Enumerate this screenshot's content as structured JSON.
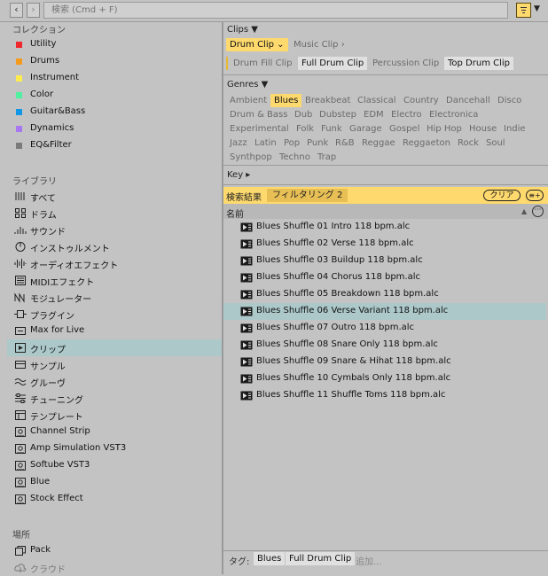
{
  "topbar": {
    "back_icon": "chevron-left-icon",
    "forward_icon": "chevron-right-icon",
    "search_placeholder": "検索 (Cmd + F)",
    "filter_icon": "filter-view-icon",
    "dropdown_glyph": "▼"
  },
  "sidebar": {
    "collections_title": "コレクション",
    "collections": [
      {
        "label": "Utility",
        "color": "#f0282d"
      },
      {
        "label": "Drums",
        "color": "#f49a1d"
      },
      {
        "label": "Instrument",
        "color": "#fcec4e"
      },
      {
        "label": "Color",
        "color": "#4ff0a0"
      },
      {
        "label": "Guitar&Bass",
        "color": "#1296e6"
      },
      {
        "label": "Dynamics",
        "color": "#a878f0"
      },
      {
        "label": "EQ&Filter",
        "color": "#7a7a7a"
      }
    ],
    "library_title": "ライブラリ",
    "library": [
      {
        "label": "すべて",
        "icon": "all-items-icon"
      },
      {
        "label": "ドラム",
        "icon": "drums-grid-icon"
      },
      {
        "label": "サウンド",
        "icon": "sounds-icon"
      },
      {
        "label": "インストゥルメント",
        "icon": "instrument-icon"
      },
      {
        "label": "オーディオエフェクト",
        "icon": "audio-effect-icon"
      },
      {
        "label": "MIDIエフェクト",
        "icon": "midi-effect-icon"
      },
      {
        "label": "モジュレーター",
        "icon": "modulator-icon"
      },
      {
        "label": "プラグイン",
        "icon": "plugin-icon"
      },
      {
        "label": "Max for Live",
        "icon": "max-for-live-icon"
      },
      {
        "label": "クリップ",
        "icon": "clip-icon",
        "selected": true
      },
      {
        "label": "サンプル",
        "icon": "sample-icon"
      },
      {
        "label": "グルーヴ",
        "icon": "groove-icon"
      },
      {
        "label": "チューニング",
        "icon": "tuning-icon"
      },
      {
        "label": "テンプレート",
        "icon": "template-icon"
      },
      {
        "label": "Channel Strip",
        "icon": "pack-folder-icon"
      },
      {
        "label": "Amp Simulation VST3",
        "icon": "pack-folder-icon"
      },
      {
        "label": "Softube VST3",
        "icon": "pack-folder-icon"
      },
      {
        "label": "Blue",
        "icon": "pack-folder-icon"
      },
      {
        "label": "Stock Effect",
        "icon": "pack-folder-icon"
      }
    ],
    "places_title": "場所",
    "places": [
      {
        "label": "Pack",
        "icon": "pack-icon"
      },
      {
        "label": "クラウド",
        "icon": "cloud-icon"
      }
    ]
  },
  "filters": {
    "clips_header": "Clips ▼",
    "clip_types": [
      {
        "label": "Drum Clip ⌄",
        "state": "selected"
      },
      {
        "label": "Music Clip ›",
        "state": "muted"
      }
    ],
    "clip_subtypes": [
      {
        "label": "Drum Fill Clip",
        "state": "muted"
      },
      {
        "label": "Full Drum Clip",
        "state": "boxed"
      },
      {
        "label": "Percussion Clip",
        "state": "muted"
      },
      {
        "label": "Top Drum Clip",
        "state": "boxed"
      }
    ],
    "genres_header": "Genres ▼",
    "genres": [
      {
        "label": "Ambient",
        "state": "muted"
      },
      {
        "label": "Blues",
        "state": "selected"
      },
      {
        "label": "Breakbeat",
        "state": "muted"
      },
      {
        "label": "Classical",
        "state": "muted"
      },
      {
        "label": "Country",
        "state": "muted"
      },
      {
        "label": "Dancehall",
        "state": "muted"
      },
      {
        "label": "Disco",
        "state": "muted"
      },
      {
        "label": "Drum & Bass",
        "state": "muted"
      },
      {
        "label": "Dub",
        "state": "muted"
      },
      {
        "label": "Dubstep",
        "state": "muted"
      },
      {
        "label": "EDM",
        "state": "muted"
      },
      {
        "label": "Electro",
        "state": "muted"
      },
      {
        "label": "Electronica",
        "state": "muted"
      },
      {
        "label": "Experimental",
        "state": "muted"
      },
      {
        "label": "Folk",
        "state": "muted"
      },
      {
        "label": "Funk",
        "state": "muted"
      },
      {
        "label": "Garage",
        "state": "muted"
      },
      {
        "label": "Gospel",
        "state": "muted"
      },
      {
        "label": "Hip Hop",
        "state": "muted"
      },
      {
        "label": "House",
        "state": "muted"
      },
      {
        "label": "Indie",
        "state": "muted"
      },
      {
        "label": "Jazz",
        "state": "muted"
      },
      {
        "label": "Latin",
        "state": "muted"
      },
      {
        "label": "Pop",
        "state": "muted"
      },
      {
        "label": "Punk",
        "state": "muted"
      },
      {
        "label": "R&B",
        "state": "muted"
      },
      {
        "label": "Reggae",
        "state": "muted"
      },
      {
        "label": "Reggaeton",
        "state": "muted"
      },
      {
        "label": "Rock",
        "state": "muted"
      },
      {
        "label": "Soul",
        "state": "muted"
      },
      {
        "label": "Synthpop",
        "state": "muted"
      },
      {
        "label": "Techno",
        "state": "muted"
      },
      {
        "label": "Trap",
        "state": "muted"
      }
    ],
    "key_header": "Key ▸"
  },
  "results": {
    "label": "検索結果",
    "filter_badge": "フィルタリング 2",
    "clear_label": "クリア",
    "add_glyph": "≡+",
    "column_name": "名前",
    "sort_glyph": "▲",
    "options_glyph": "···",
    "items": [
      {
        "name": "Blues Shuffle 01 Intro 118 bpm.alc"
      },
      {
        "name": "Blues Shuffle 02 Verse 118 bpm.alc"
      },
      {
        "name": "Blues Shuffle 03 Buildup 118 bpm.alc"
      },
      {
        "name": "Blues Shuffle 04 Chorus 118 bpm.alc"
      },
      {
        "name": "Blues Shuffle 05 Breakdown 118 bpm.alc"
      },
      {
        "name": "Blues Shuffle 06 Verse Variant 118 bpm.alc",
        "selected": true
      },
      {
        "name": "Blues Shuffle 07 Outro 118 bpm.alc"
      },
      {
        "name": "Blues Shuffle 08 Snare Only 118 bpm.alc"
      },
      {
        "name": "Blues Shuffle 09 Snare & Hihat 118 bpm.alc"
      },
      {
        "name": "Blues Shuffle 10 Cymbals Only 118 bpm.alc"
      },
      {
        "name": "Blues Shuffle 11 Shuffle Toms 118 bpm.alc"
      }
    ]
  },
  "tags": {
    "label": "タグ:",
    "items": [
      "Blues",
      "Full Drum Clip"
    ],
    "add_placeholder": "追加..."
  }
}
